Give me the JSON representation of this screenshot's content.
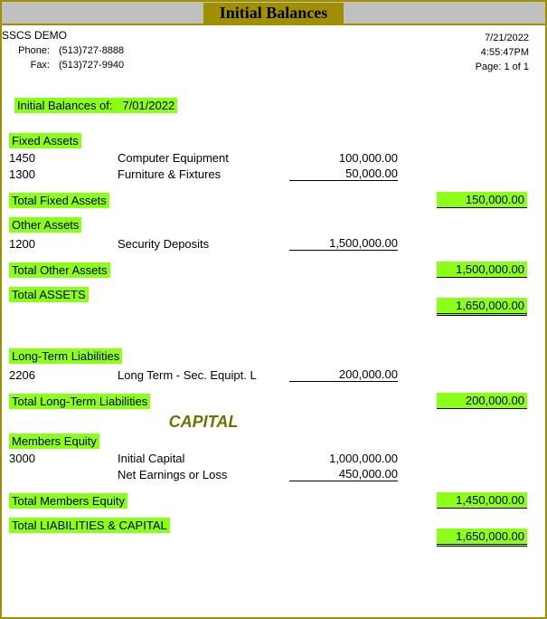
{
  "title": "Initial Balances",
  "company": "SSCS DEMO",
  "contact": {
    "phone_label": "Phone:",
    "phone": "(513)727-8888",
    "fax_label": "Fax:",
    "fax": "(513)727-9940"
  },
  "meta": {
    "date": "7/21/2022",
    "time": "4:55:47PM",
    "page": "Page: 1 of 1"
  },
  "as_of": {
    "label": "Initial Balances of:",
    "date": "7/01/2022"
  },
  "capital_heading": "CAPITAL",
  "sections": [
    {
      "name": "Fixed Assets",
      "items": [
        {
          "acct": "1450",
          "desc": "Computer Equipment",
          "amount": "100,000.00"
        },
        {
          "acct": "1300",
          "desc": "Furniture & Fixtures",
          "amount": "50,000.00"
        }
      ],
      "total_label": "Total Fixed Assets",
      "total_amount": "150,000.00"
    },
    {
      "name": "Other Assets",
      "items": [
        {
          "acct": "1200",
          "desc": "Security Deposits",
          "amount": "1,500,000.00"
        }
      ],
      "total_label": "Total Other Assets",
      "total_amount": "1,500,000.00"
    },
    {
      "name": "Long-Term Liabilities",
      "items": [
        {
          "acct": "2206",
          "desc": "Long Term - Sec. Equipt. L",
          "amount": "200,000.00"
        }
      ],
      "total_label": "Total Long-Term Liabilities",
      "total_amount": "200,000.00"
    },
    {
      "name": "Members Equity",
      "items": [
        {
          "acct": "3000",
          "desc": "Initial Capital",
          "amount": "1,000,000.00"
        },
        {
          "acct": "",
          "desc": "Net Earnings or Loss",
          "amount": "450,000.00"
        }
      ],
      "total_label": "Total Members Equity",
      "total_amount": "1,450,000.00"
    }
  ],
  "grand_totals": [
    {
      "label": "Total ASSETS",
      "amount": "1,650,000.00"
    },
    {
      "label": "Total LIABILITIES & CAPITAL",
      "amount": "1,650,000.00"
    }
  ]
}
